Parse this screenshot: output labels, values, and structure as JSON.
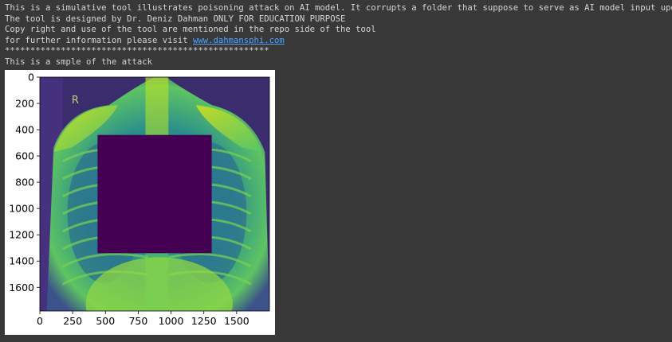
{
  "output": {
    "lines": [
      "This is a simulative tool illustrates poisoning attack on AI model. It corrupts a folder that suppose to serve as AI model input update",
      "The tool is designed by Dr. Deniz Dahman ONLY FOR EDUCATION PURPOSE",
      "Copy right and use of the tool are mentioned in the repo side of the tool"
    ],
    "info_prefix": "for further information please visit ",
    "info_link": "www.dahmansphi.com",
    "separator": "****************************************************",
    "sample_caption": "This is a smple of the attack"
  },
  "chart_data": {
    "type": "heatmap",
    "title": "",
    "xlabel": "",
    "ylabel": "",
    "xlim": [
      0,
      1750
    ],
    "ylim": [
      1780,
      0
    ],
    "x_ticks": [
      0,
      250,
      500,
      750,
      1000,
      1250,
      1500
    ],
    "y_ticks": [
      0,
      200,
      400,
      600,
      800,
      1000,
      1200,
      1400,
      1600
    ],
    "colormap": "viridis",
    "image_marker": "R",
    "image_marker_pos": [
      270,
      180
    ],
    "poison_patch": {
      "x_range": [
        440,
        1310
      ],
      "y_range": [
        440,
        1340
      ],
      "color": "#440154"
    }
  }
}
